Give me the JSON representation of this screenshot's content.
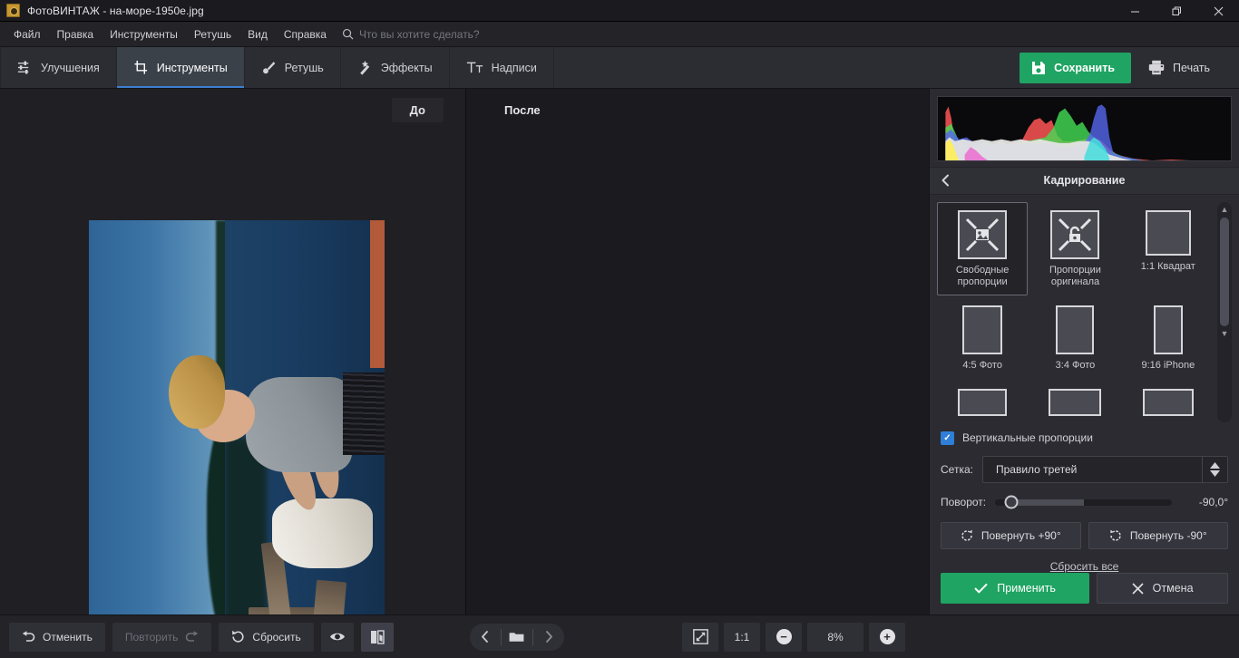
{
  "window": {
    "title": "ФотоВИНТАЖ - на-море-1950e.jpg",
    "minimize": "−",
    "restore": "❐",
    "close": "✕"
  },
  "menu": {
    "items": [
      "Файл",
      "Правка",
      "Инструменты",
      "Ретушь",
      "Вид",
      "Справка"
    ],
    "search_placeholder": "Что вы хотите сделать?"
  },
  "tabs": [
    {
      "label": "Улучшения",
      "icon": "sliders-icon",
      "active": false
    },
    {
      "label": "Инструменты",
      "icon": "crop-icon",
      "active": true
    },
    {
      "label": "Ретушь",
      "icon": "brush-icon",
      "active": false
    },
    {
      "label": "Эффекты",
      "icon": "magic-wand-icon",
      "active": false
    },
    {
      "label": "Надписи",
      "icon": "text-icon",
      "active": false
    }
  ],
  "actions": {
    "save": "Сохранить",
    "print": "Печать"
  },
  "canvas": {
    "before_label": "До",
    "after_label": "После"
  },
  "panel": {
    "title": "Кадрирование",
    "presets": [
      {
        "label": "Свободные\nпропорции",
        "line1": "Свободные",
        "line2": "пропорции",
        "active": true
      },
      {
        "label": "Пропорции\nоригинала",
        "line1": "Пропорции",
        "line2": "оригинала",
        "active": false
      },
      {
        "label": "1:1 Квадрат",
        "line1": "1:1 Квадрат",
        "line2": "",
        "active": false
      },
      {
        "label": "4:5 Фото",
        "line1": "4:5 Фото",
        "line2": "",
        "active": false
      },
      {
        "label": "3:4 Фото",
        "line1": "3:4 Фото",
        "line2": "",
        "active": false
      },
      {
        "label": "9:16 iPhone",
        "line1": "9:16 iPhone",
        "line2": "",
        "active": false
      }
    ],
    "vertical_proportions": "Вертикальные пропорции",
    "vertical_checked": true,
    "grid_label": "Сетка:",
    "grid_value": "Правило третей",
    "rotation_label": "Поворот:",
    "rotation_value": "-90,0°",
    "rotate_plus": "Повернуть +90°",
    "rotate_minus": "Повернуть -90°",
    "reset_all": "Сбросить все",
    "apply": "Применить",
    "cancel": "Отмена"
  },
  "bottom": {
    "undo": "Отменить",
    "redo": "Повторить",
    "reset": "Сбросить",
    "fit_label": "fit-screen-icon",
    "one_to_one": "1:1",
    "zoom_value": "8%",
    "zoom_out": "−",
    "zoom_in": "+"
  },
  "colors": {
    "accent_green": "#1fa463",
    "accent_blue": "#2f7fd8",
    "panel_bg": "#2b2b31",
    "window_bg": "#1e1e22"
  }
}
